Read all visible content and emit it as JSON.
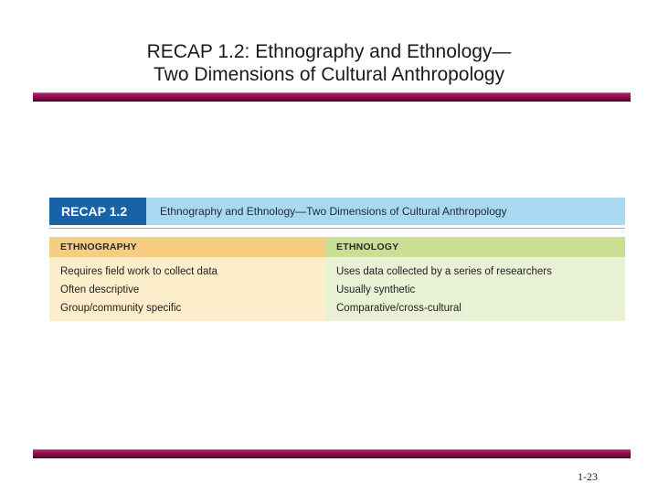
{
  "slide": {
    "title_line1": "RECAP 1.2:  Ethnography and Ethnology—",
    "title_line2": "Two Dimensions of Cultural Anthropology",
    "page_number": "1-23"
  },
  "recap": {
    "badge": "RECAP 1.2",
    "subtitle": "Ethnography and Ethnology—Two Dimensions of Cultural Anthropology",
    "columns": [
      {
        "header": "ETHNOGRAPHY",
        "items": [
          "Requires field work to collect data",
          "Often descriptive",
          "Group/community specific"
        ]
      },
      {
        "header": "ETHNOLOGY",
        "items": [
          "Uses data collected by a series of researchers",
          "Usually synthetic",
          "Comparative/cross-cultural"
        ]
      }
    ]
  },
  "colors": {
    "rule": "#8e1050",
    "badge": "#1763a6",
    "header_band": "#a9d8f0",
    "ethnography_header": "#f7cd82",
    "ethnography_body": "#fdeecb",
    "ethnology_header": "#c9df94",
    "ethnology_body": "#e9f1d4"
  }
}
